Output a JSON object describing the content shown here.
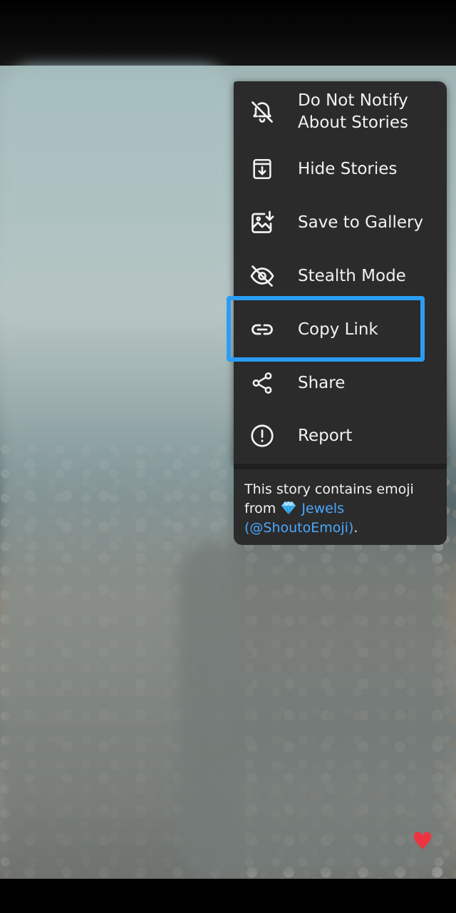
{
  "menu": {
    "items": [
      {
        "label_line1": "Do Not Notify",
        "label_line2": "About Stories",
        "icon": "bell-off-icon"
      },
      {
        "label": "Hide Stories",
        "icon": "archive-icon"
      },
      {
        "label": "Save to Gallery",
        "icon": "save-gallery-icon"
      },
      {
        "label": "Stealth Mode",
        "icon": "eye-off-icon"
      },
      {
        "label": "Copy Link",
        "icon": "link-icon"
      },
      {
        "label": "Share",
        "icon": "share-icon"
      },
      {
        "label": "Report",
        "icon": "report-icon"
      }
    ],
    "highlighted_item": "Copy Link",
    "highlight_color": "#2a9df4"
  },
  "emoji_note": {
    "text_before": "This story contains emoji from ",
    "emoji_icon": "gem-icon",
    "link_text": "Jewels (@ShoutoEmoji)",
    "text_after": ".",
    "link_color": "#4aa8ff"
  },
  "story": {
    "reaction_icon": "heart-icon",
    "reaction_color": "#ef3340"
  },
  "colors": {
    "menu_background": "#2b2b2b",
    "menu_text": "#f2f2f2"
  }
}
